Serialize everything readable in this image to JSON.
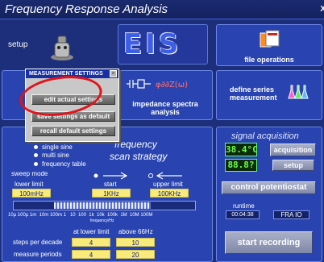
{
  "window": {
    "title": "Frequency Response Analysis",
    "close": "X"
  },
  "top": {
    "setup_label": "setup",
    "eis_logo": "EIS",
    "file_operations": "file operations"
  },
  "middle": {
    "impedance_label": "impedance spectra\nanalysis",
    "define_series": "define series\nmeasurement"
  },
  "popup": {
    "title": "MEASUREMENT SETTINGS",
    "items": [
      "edit actual settings",
      "save settings as default",
      "recall default settings"
    ]
  },
  "scan": {
    "title_line1": "frequency",
    "title_line2": "scan strategy",
    "options": [
      "single sine",
      "multi sine",
      "frequency table"
    ],
    "sweep_mode_label": "sweep mode",
    "lower_limit_label": "lower limit",
    "start_label": "start",
    "upper_limit_label": "upper limit",
    "lower_limit": "100mHz",
    "start": "1KHz",
    "upper_limit": "100KHz",
    "axis_ticks": "10μ 100μ 1m  10m 100m 1   10  100  1k  10k  100k  1M  10M 100M",
    "axis_unit": "frequency/Hz",
    "at_lower_label": "at lower limit",
    "above_label": "above 66Hz",
    "steps_label": "steps per decade",
    "steps_low": "4",
    "steps_high": "10",
    "periods_label": "measure periods",
    "periods_low": "4",
    "periods_high": "20"
  },
  "signal": {
    "title": "signal acquisition",
    "temp": "38.4°C",
    "value": "88.8?",
    "acquisition_btn": "acquisition",
    "setup_btn": "setup",
    "control_btn": "control potentiostat",
    "runtime_label": "runtime",
    "runtime": "00:04:38",
    "fra_io": "FRA IO",
    "start_btn": "start recording"
  },
  "colors": {
    "background": "#1d2f7a",
    "panel": "#2944b0",
    "field": "#f8eb7c",
    "lcd": "#6dff4a",
    "highlight": "#e0141b"
  }
}
